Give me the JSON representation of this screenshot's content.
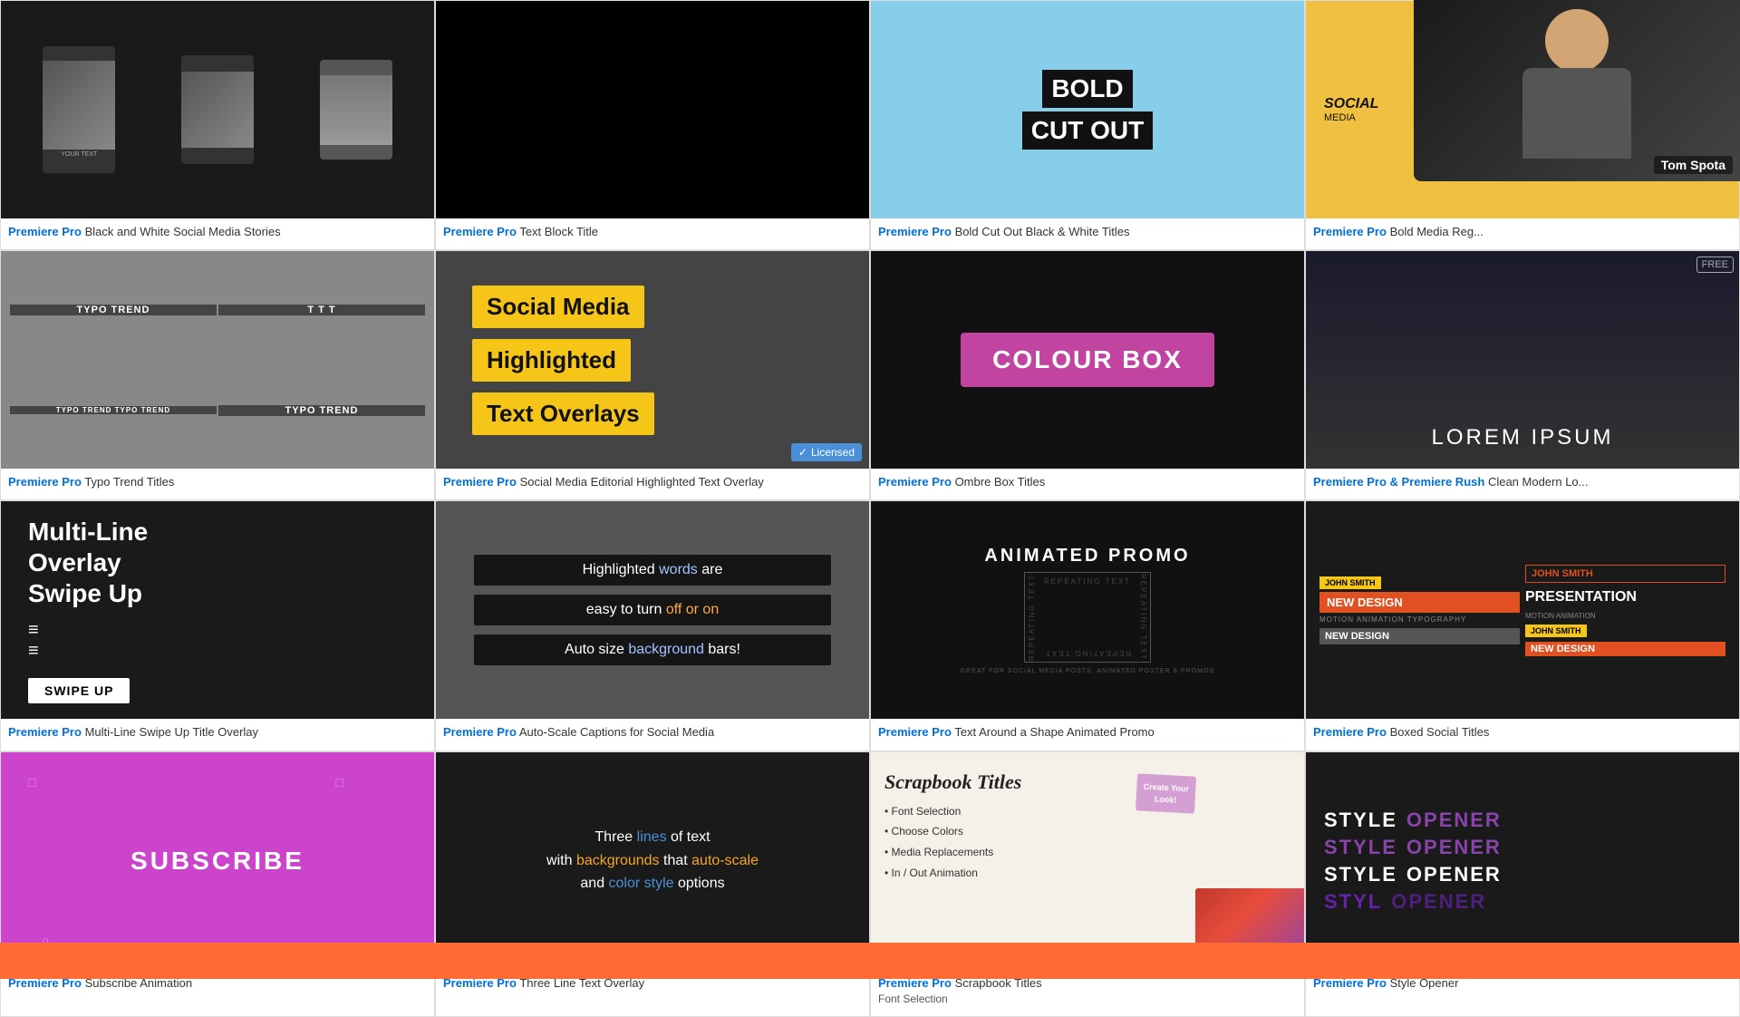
{
  "grid": {
    "items": [
      {
        "id": "bw-social-stories",
        "brand": "Premiere Pro",
        "title": "Black and White Social Media Stories",
        "row": 1,
        "col": 1,
        "type": "bw-social"
      },
      {
        "id": "text-block-title",
        "brand": "Premiere Pro",
        "title": "Text Block Title",
        "row": 1,
        "col": 2,
        "type": "text-block"
      },
      {
        "id": "bold-cutout-bw",
        "brand": "Premiere Pro",
        "title": "Bold Cut Out Black & White Titles",
        "row": 1,
        "col": 3,
        "type": "bold-bw"
      },
      {
        "id": "bold-media-reg",
        "brand": "Premiere Pro",
        "title": "Bold Media Reg...",
        "row": 1,
        "col": 4,
        "type": "bold-media"
      },
      {
        "id": "typo-trend",
        "brand": "Premiere Pro",
        "title": "Typo Trend Titles",
        "row": 2,
        "col": 1,
        "type": "typo-trend"
      },
      {
        "id": "social-editorial",
        "brand": "Premiere Pro",
        "title": "Social Media Editorial Highlighted Text Overlay",
        "row": 2,
        "col": 2,
        "type": "social-editorial",
        "licensed": true,
        "licensed_label": "✓ Licensed"
      },
      {
        "id": "ombre-box",
        "brand": "Premiere Pro",
        "title": "Ombre Box Titles",
        "row": 2,
        "col": 3,
        "type": "ombre-box"
      },
      {
        "id": "clean-modern",
        "brand": "Premiere Pro & Premiere Rush",
        "title": "Clean Modern Lo...",
        "row": 2,
        "col": 4,
        "type": "clean-modern",
        "free": true,
        "free_label": "FREE"
      },
      {
        "id": "multiline-swipe",
        "brand": "Premiere Pro",
        "title": "Multi-Line Swipe Up Title Overlay",
        "row": 3,
        "col": 1,
        "type": "multiline"
      },
      {
        "id": "auto-scale-captions",
        "brand": "Premiere Pro",
        "title": "Auto-Scale Captions for Social Media",
        "row": 3,
        "col": 2,
        "type": "auto-scale"
      },
      {
        "id": "text-around-shape",
        "brand": "Premiere Pro",
        "title": "Text Around a Shape Animated Promo",
        "row": 3,
        "col": 3,
        "type": "animated-promo"
      },
      {
        "id": "boxed-social",
        "brand": "Premiere Pro",
        "title": "Boxed Social Titles",
        "row": 3,
        "col": 4,
        "type": "boxed-social"
      },
      {
        "id": "subscribe",
        "brand": "Premiere Pro",
        "title": "Subscribe Animation",
        "row": 4,
        "col": 1,
        "type": "subscribe"
      },
      {
        "id": "three-lines",
        "brand": "Premiere Pro",
        "title": "Three Line Text Overlay",
        "row": 4,
        "col": 2,
        "type": "three-lines"
      },
      {
        "id": "scrapbook-titles",
        "brand": "Premiere Pro",
        "title": "Scrapbook Titles",
        "subtitle": "Font Selection",
        "row": 4,
        "col": 3,
        "type": "scrapbook"
      },
      {
        "id": "style-opener",
        "brand": "Premiere Pro",
        "title": "Style Opener",
        "row": 4,
        "col": 4,
        "type": "style-opener"
      }
    ]
  },
  "thumbnails": {
    "social_editorial": {
      "line1": "Social Media",
      "line2": "Highlighted",
      "line3": "Text Overlays"
    },
    "colour_box": {
      "text": "COLOUR BOX"
    },
    "lorem_ipsum": {
      "text": "LOREM IPSUM"
    },
    "typo": {
      "text": "TYPO TREND"
    },
    "multiline": {
      "line1": "Multi-Line",
      "line2": "Overlay",
      "line3": "Swipe Up",
      "swipe": "SWIPE UP"
    },
    "captions": {
      "line1_pre": "Highlighted",
      "line1_highlight": "words",
      "line1_post": "are",
      "line2_pre": "easy to turn",
      "line2_highlight": "off or on",
      "line3_pre": "Auto size",
      "line3_highlight": "background",
      "line3_post": "bars!"
    },
    "promo": {
      "title": "ANIMATED PROMO",
      "repeating": "REPEATING TEXT",
      "subtitle": "GREAT FOR SOCIAL MEDIA POSTS, ANIMATED POSTER & PROMOS"
    },
    "boxed": {
      "name1": "JOHN SMITH",
      "design1": "NEW DESIGN",
      "design2": "NEW DESIGN",
      "name2": "JOHN SMITH",
      "presentation": "PRESENTATION"
    },
    "subscribe": {
      "text": "SUBSCRIBE"
    },
    "three_lines": {
      "text": "Three lines of text\nwith backgrounds that auto-scale\nand color style options"
    },
    "scrapbook": {
      "title": "Scrapbook Titles",
      "bullets": "• Font Selection\n• Choose Colors\n• Media Replacements\n• In / Out Animation",
      "create_tag": "Create Your Look!"
    },
    "style_opener": {
      "text": "STYLE OPENER"
    }
  },
  "webcam": {
    "name": "Tom Spota"
  },
  "colors": {
    "brand_blue": "#0070d8",
    "highlight_yellow": "#f5c518",
    "colour_box_pink": "#c044a0",
    "licensed_blue": "#4a90d9",
    "subscribe_purple": "#cc44cc",
    "new_design_orange": "#e05020",
    "bottom_bar_orange": "#ff6b35"
  }
}
